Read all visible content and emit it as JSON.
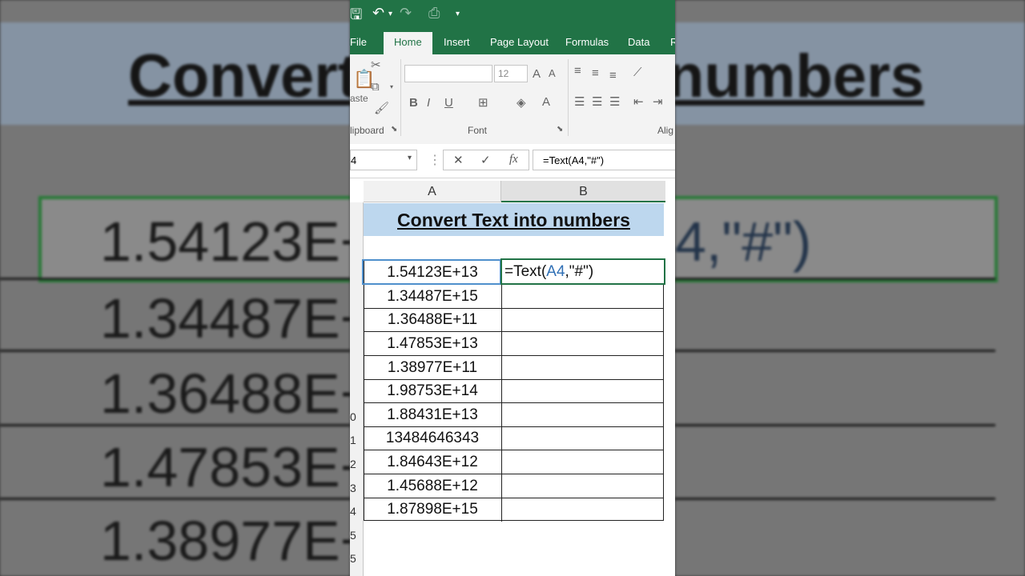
{
  "background": {
    "title_fragment_left": "Convert",
    "title_fragment_right": "numbers",
    "left_values": [
      "1.54123E+",
      "1.34487E+",
      "1.36488E+",
      "1.47853E+",
      "1.38977E+"
    ],
    "right_formula_fragment": "4,\"#\")"
  },
  "quick_access": {
    "save_icon": "save-icon",
    "undo_icon": "undo-icon",
    "redo_icon": "redo-icon",
    "preview_icon": "print-preview-icon",
    "customize_icon": "customize-qat-icon"
  },
  "tabs": [
    {
      "label": "File"
    },
    {
      "label": "Home"
    },
    {
      "label": "Insert"
    },
    {
      "label": "Page Layout"
    },
    {
      "label": "Formulas"
    },
    {
      "label": "Data"
    },
    {
      "label": "R"
    }
  ],
  "ribbon": {
    "clipboard_label": "lipboard",
    "paste_label": "aste",
    "font_group_label": "Font",
    "alignment_label": "Alig",
    "font_name": "",
    "font_size": "12",
    "bold": "B",
    "italic": "I",
    "underline": "U",
    "font_color": "A"
  },
  "formula_bar": {
    "name_box": "4",
    "cancel": "✕",
    "enter": "✓",
    "fx": "fx",
    "formula": "=Text(A4,\"#\")"
  },
  "columns": [
    "A",
    "B"
  ],
  "sheet": {
    "title": "Convert Text into numbers",
    "active_cell_prefix": "=Text(",
    "active_cell_ref": "A4",
    "active_cell_suffix": ",\"#\")",
    "row_numbers": [
      "",
      "",
      "",
      "",
      "",
      "0",
      "1",
      "2",
      "3",
      "4",
      "5",
      "5"
    ],
    "values": [
      "1.54123E+13",
      "1.34487E+15",
      "1.36488E+11",
      "1.47853E+13",
      "1.38977E+11",
      "1.98753E+14",
      "1.88431E+13",
      "13484646343",
      "1.84643E+12",
      "1.45688E+12",
      "1.87898E+15"
    ]
  },
  "colors": {
    "excel_green": "#217346",
    "title_fill": "#bdd7ee",
    "reference_blue": "#2f6fb5"
  }
}
